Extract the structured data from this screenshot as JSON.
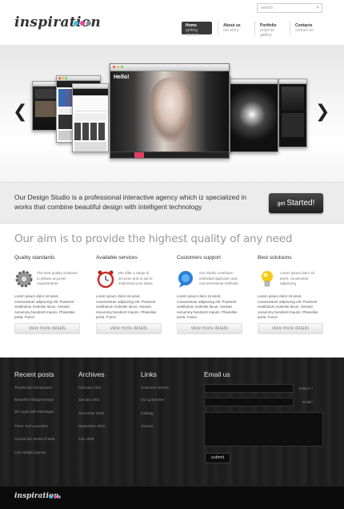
{
  "header": {
    "logo": "inspiration",
    "logo_dots": [
      "#35c3e4",
      "#e8499d",
      "#8a8a8a"
    ],
    "search_placeholder": "search",
    "nav": [
      {
        "title": "Home",
        "sub": "getting started",
        "active": true
      },
      {
        "title": "About us",
        "sub": "our story"
      },
      {
        "title": "Portfolio",
        "sub": "projects gallery"
      },
      {
        "title": "Contacts",
        "sub": "contact us"
      }
    ]
  },
  "slider": {
    "prev_icon": "chevron-left-icon",
    "next_icon": "chevron-right-icon",
    "prev_glyph": "❮",
    "next_glyph": "❯",
    "center_hello": "Hello!"
  },
  "banner": {
    "text": "Our Design Studio is a professional interactive agency which iz specialized in works that combine beautiful design with intelligent technology",
    "button_pre": "get ",
    "button_main": "Started!"
  },
  "aim": {
    "heading": "Our aim is to provide the highest quality of any need",
    "columns": [
      {
        "title": "Quality standards",
        "desc": "The best quality solutions to please anyones requirements",
        "body": "Lorem ipsum dolor sit amet, consectetuer adipiscing elit. Praesent vestibulum molestie lacus. Aenean nonummy hendrerit mauris. Phasellus porta. Fusce",
        "more": "view more details",
        "icon": "gear-icon"
      },
      {
        "title": "Available services",
        "desc": "We offer a range of services and to aid to implement your ideas",
        "body": "Lorem ipsum dolor sit amet, consectetuer adipiscing elit. Praesent vestibulum molestie lacus. Aenean nonummy hendrerit mauris. Phasellus porta. Fusce",
        "more": "view more details",
        "icon": "alarm-clock-icon"
      },
      {
        "title": "Customers support",
        "desc": "Our Studio combines individual approach and unconventional methods",
        "body": "Lorem ipsum dolor sit amet, consectetuer adipiscing elit. Praesent vestibulum molestie lacus. Aenean nonummy hendrerit mauris. Phasellus porta. Fusce",
        "more": "view more details",
        "icon": "chat-icon"
      },
      {
        "title": "Best solutuons",
        "desc": "Lorem ipsum dolor sit amet, consectetur adipiscing",
        "body": "Lorem ipsum dolor sit amet, consectetuer adipiscing elit. Praesent vestibulum molestie lacus. Aenean nonummy hendrerit mauris. Phasellus porta. Fusce",
        "more": "view more details",
        "icon": "lightbulb-icon"
      }
    ]
  },
  "footer": {
    "recent_title": "Recent posts",
    "recent": [
      "Trends and Showcases",
      "Beautiful Vintage Design",
      "35 Logos with Messages",
      "Three Tool Launches",
      "Around the World of Web",
      "CSS Media Queries"
    ],
    "archives_title": "Archives",
    "archives": [
      "February 2011",
      "January 2011",
      "December 2010",
      "September 2010",
      "July 2009"
    ],
    "links_title": "Links",
    "links": [
      "Customer service",
      "Our guarantee",
      "Catalog",
      "Journal"
    ],
    "email_title": "Email us",
    "subject_label": "Subject *",
    "email_label": "Email *",
    "submit": "submit",
    "bottom_logo": "inspiration"
  }
}
